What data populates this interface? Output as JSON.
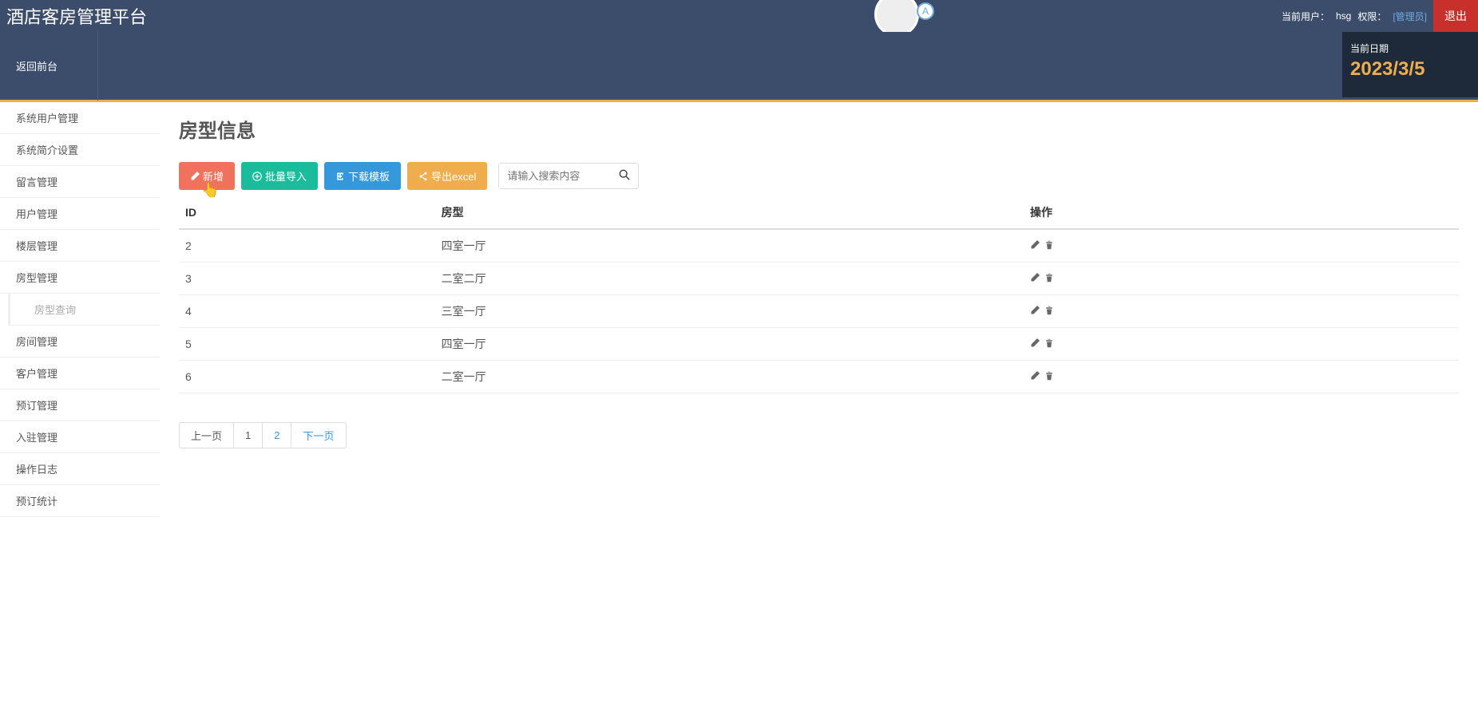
{
  "header": {
    "title": "酒店客房管理平台",
    "back_front": "返回前台",
    "current_user_label": "当前用户：",
    "current_user": "hsg",
    "role_label": "权限：",
    "role": "[管理员]",
    "logout": "退出",
    "avatar_letter": "A",
    "date_label": "当前日期",
    "date_value": "2023/3/5"
  },
  "sidebar": {
    "items": [
      {
        "label": "系统用户管理"
      },
      {
        "label": "系统简介设置"
      },
      {
        "label": "留言管理"
      },
      {
        "label": "用户管理"
      },
      {
        "label": "楼层管理"
      },
      {
        "label": "房型管理"
      },
      {
        "label": "房型查询",
        "sub": true
      },
      {
        "label": "房间管理"
      },
      {
        "label": "客户管理"
      },
      {
        "label": "预订管理"
      },
      {
        "label": "入驻管理"
      },
      {
        "label": "操作日志"
      },
      {
        "label": "预订统计"
      }
    ]
  },
  "page": {
    "title": "房型信息"
  },
  "toolbar": {
    "add": "新增",
    "import": "批量导入",
    "download": "下载模板",
    "export": "导出excel",
    "search_placeholder": "请输入搜索内容"
  },
  "table": {
    "headers": {
      "id": "ID",
      "type": "房型",
      "action": "操作"
    },
    "rows": [
      {
        "id": "2",
        "type": "四室一厅"
      },
      {
        "id": "3",
        "type": "二室二厅"
      },
      {
        "id": "4",
        "type": "三室一厅"
      },
      {
        "id": "5",
        "type": "四室一厅"
      },
      {
        "id": "6",
        "type": "二室一厅"
      }
    ]
  },
  "pagination": {
    "prev": "上一页",
    "p1": "1",
    "p2": "2",
    "next": "下一页"
  }
}
